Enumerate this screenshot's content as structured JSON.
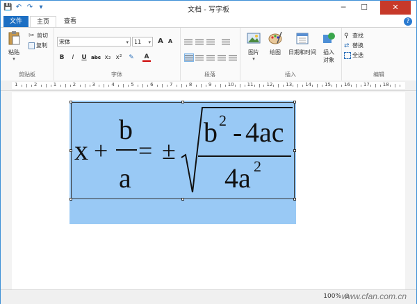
{
  "window": {
    "title": "文档 - 写字板",
    "minimize": "─",
    "maximize": "☐",
    "close": "✕"
  },
  "quick_access": {
    "save": "💾",
    "undo": "↶",
    "redo": "↷",
    "more": "▾"
  },
  "tabs": {
    "file": "文件",
    "home": "主页",
    "view": "查看"
  },
  "help": "?",
  "ribbon": {
    "clipboard": {
      "paste": "粘贴",
      "cut": "剪切",
      "copy": "复制",
      "label": "剪贴板"
    },
    "font": {
      "family": "宋体",
      "size": "11",
      "grow": "A",
      "shrink": "A",
      "bold": "B",
      "italic": "I",
      "underline": "U",
      "strike": "abc",
      "subscript": "x₂",
      "superscript": "x²",
      "highlight": "✎",
      "color": "A",
      "label": "字体"
    },
    "paragraph": {
      "label": "段落"
    },
    "insert": {
      "picture": "图片",
      "paint": "绘图",
      "datetime": "日期和时间",
      "object_line1": "插入",
      "object_line2": "对象",
      "label": "插入"
    },
    "editing": {
      "find": "查找",
      "replace": "替换",
      "select_all": "全选",
      "label": "编辑"
    }
  },
  "ruler": {
    "numbers": [
      "1",
      "2",
      "1",
      "2",
      "3",
      "4",
      "5",
      "6",
      "7",
      "8",
      "9",
      "10",
      "11",
      "12",
      "13",
      "14",
      "15",
      "16",
      "17",
      "18"
    ]
  },
  "formula": {
    "x": "x",
    "plus": "+",
    "num": "b",
    "den": "a",
    "eq": "=",
    "pm": "±",
    "rad_b": "b",
    "rad_exp": "2",
    "rad_minus": "-",
    "rad_4ac": "4ac",
    "rad_den": "4a",
    "rad_den_exp": "2"
  },
  "status": {
    "zoom": "100%",
    "zoom_out": "⊖",
    "watermark": "www.cfan.com.cn"
  },
  "colors": {
    "accent": "#1d6fc3",
    "selection": "#99c9f5"
  }
}
